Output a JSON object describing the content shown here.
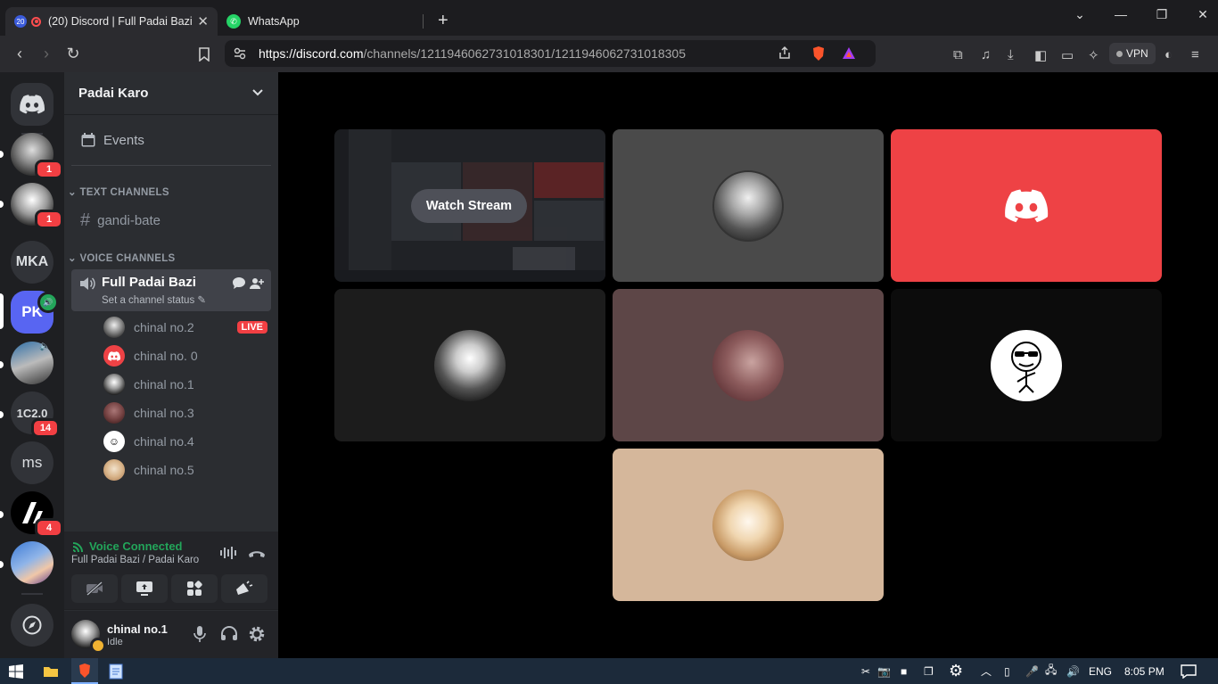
{
  "browser": {
    "tabs": [
      {
        "title": "(20) Discord | Full Padai Bazi",
        "badge": "20",
        "close_glyph": "✕"
      },
      {
        "title": "WhatsApp"
      }
    ],
    "url_domain": "https://discord.com",
    "url_path": "/channels/1211946062731018301/1211946062731018305",
    "vpn_label": "VPN"
  },
  "servers": [
    {
      "label": "",
      "icon": "discord-home-icon"
    },
    {
      "label": "",
      "badge": "1"
    },
    {
      "label": "",
      "badge": "1"
    },
    {
      "label": "MKA"
    },
    {
      "label": "PK",
      "speaking": true
    },
    {
      "label": ""
    },
    {
      "label": "1C2.0",
      "badge": "14"
    },
    {
      "label": "ms"
    },
    {
      "label": "",
      "badge": "4"
    },
    {
      "label": ""
    },
    {
      "label": "",
      "icon": "compass-icon"
    }
  ],
  "sidebar": {
    "guild_name": "Padai Karo",
    "events_label": "Events",
    "text_category": "TEXT CHANNELS",
    "text_channel": "gandi-bate",
    "voice_category": "VOICE CHANNELS",
    "voice_channel": "Full Padai Bazi",
    "channel_status": "Set a channel status",
    "voice_users": [
      {
        "name": "chinal no.2",
        "live": "LIVE"
      },
      {
        "name": "chinal no. 0"
      },
      {
        "name": "chinal no.1"
      },
      {
        "name": "chinal no.3"
      },
      {
        "name": "chinal no.4"
      },
      {
        "name": "chinal no.5"
      }
    ]
  },
  "voice_panel": {
    "status": "Voice Connected",
    "location": "Full Padai Bazi / Padai Karo"
  },
  "user_panel": {
    "name": "chinal no.1",
    "status": "Idle"
  },
  "stage": {
    "watch_stream_label": "Watch Stream"
  },
  "taskbar": {
    "language": "ENG",
    "time": "8:05 PM"
  },
  "colors": {
    "discord_red": "#ee4245",
    "voice_green": "#23a55a",
    "blurple": "#5865f2",
    "live_red": "#f23f43"
  }
}
